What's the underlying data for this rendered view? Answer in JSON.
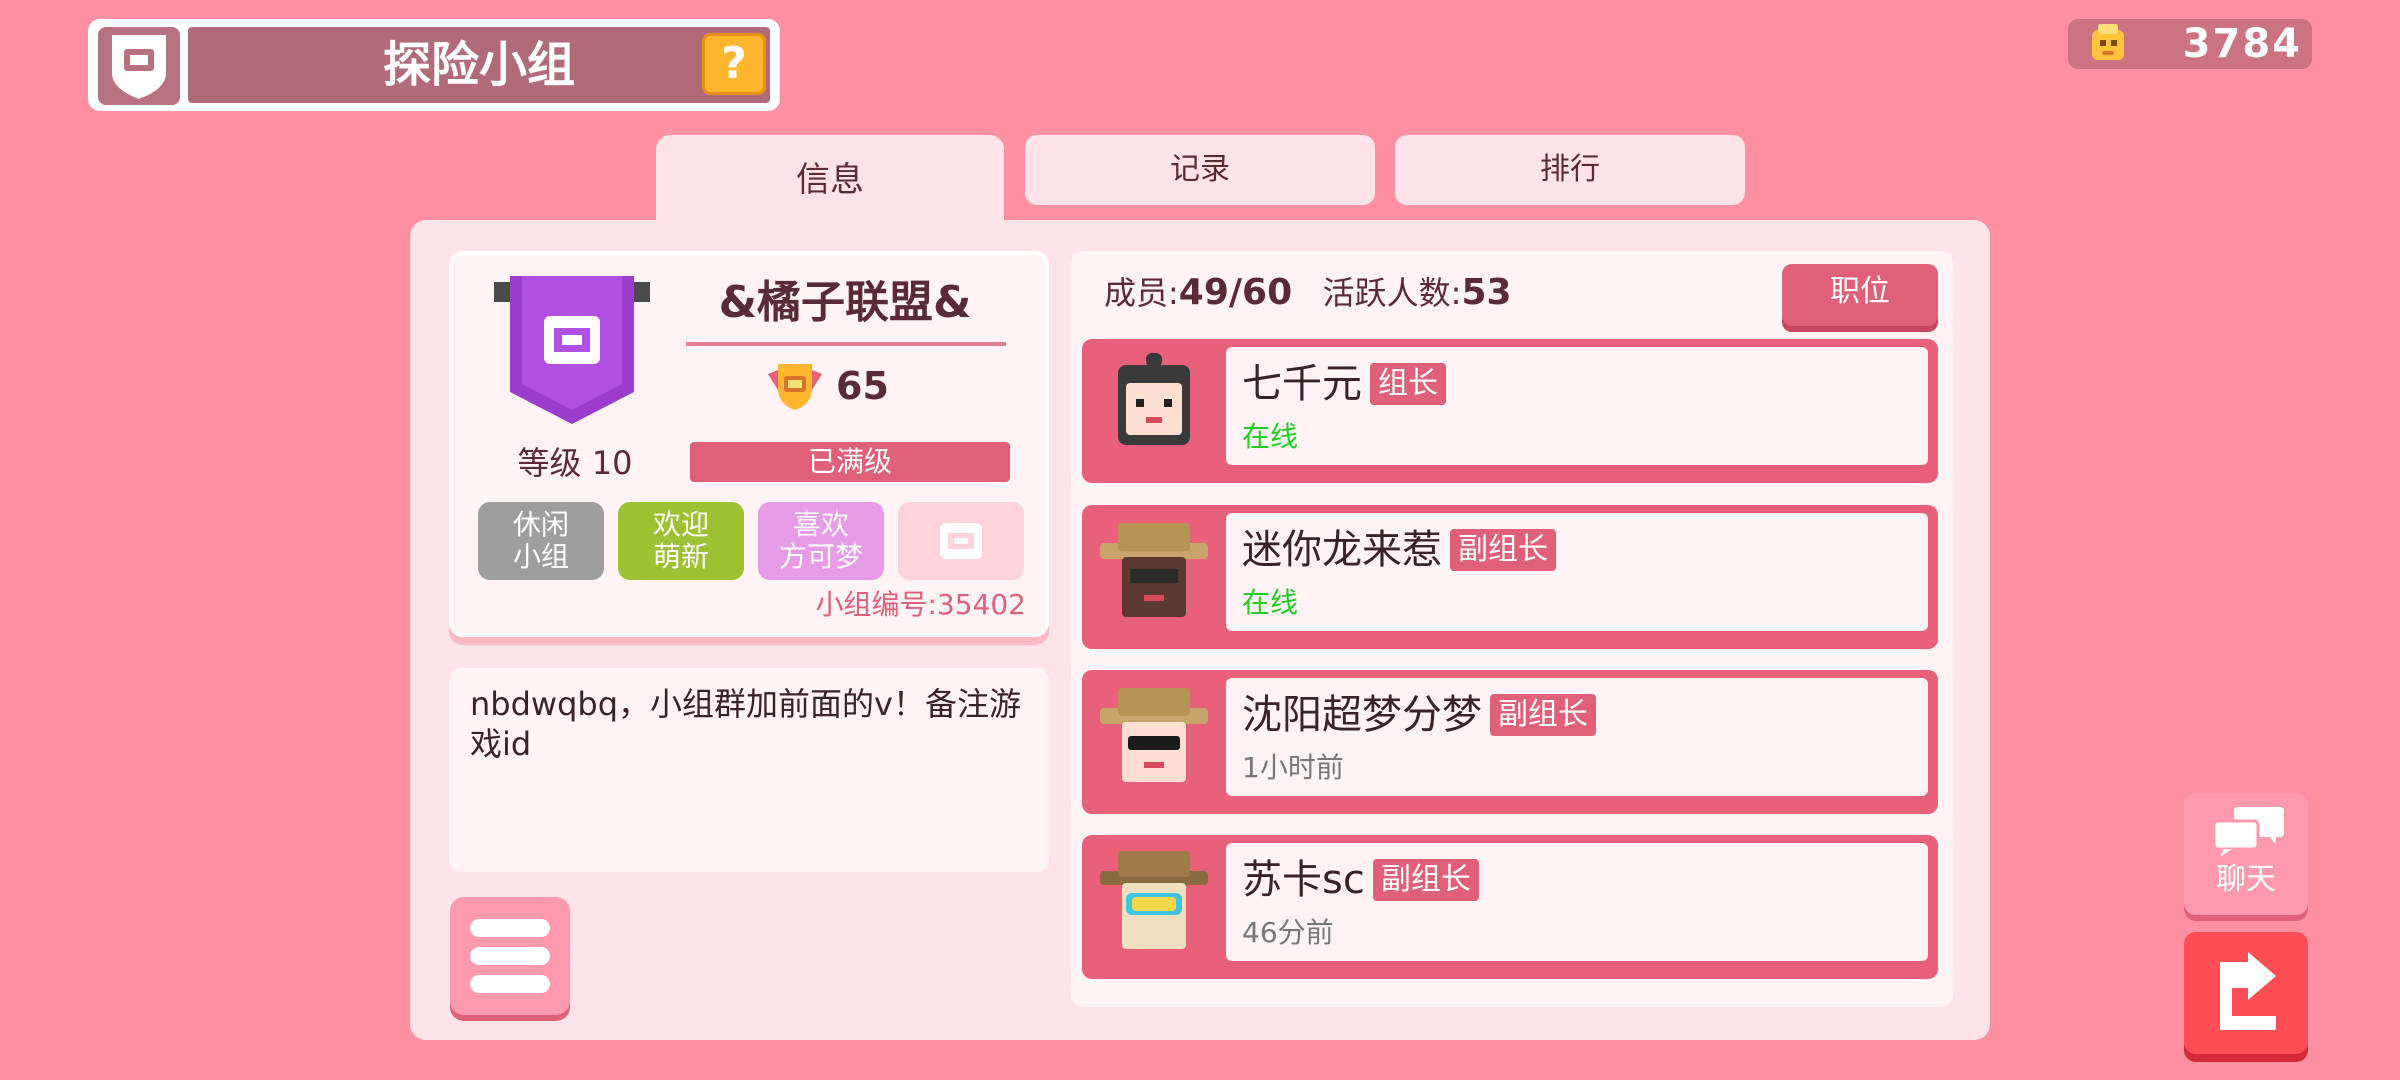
{
  "header": {
    "title": "探险小组",
    "help_icon": "question-icon",
    "coins": "3784"
  },
  "tabs": [
    {
      "label": "信息",
      "active": true
    },
    {
      "label": "记录",
      "active": false
    },
    {
      "label": "排行",
      "active": false
    }
  ],
  "group": {
    "name": "&橘子联盟&",
    "score": "65",
    "level": "等级 10",
    "level_status": "已满级",
    "tags": [
      {
        "label": "休闲\n小组",
        "color": "#9e9e9e"
      },
      {
        "label": "欢迎\n萌新",
        "color": "#9cc132"
      },
      {
        "label": "喜欢\n方可梦",
        "color": "#e79be6"
      }
    ],
    "group_id": "小组编号:35402",
    "description": "nbdwqbq，小组群加前面的v！备注游戏id"
  },
  "members_summary": {
    "count_label": "成员:",
    "count_value": "49/60",
    "active_label": "活跃人数:",
    "active_value": "53",
    "position_button": "职位"
  },
  "members": [
    {
      "name": "七千元",
      "role": "组长",
      "status": "在线",
      "online": true
    },
    {
      "name": "迷你龙来惹",
      "role": "副组长",
      "status": "在线",
      "online": true
    },
    {
      "name": "沈阳超梦分梦",
      "role": "副组长",
      "status": "1小时前",
      "online": false
    },
    {
      "name": "苏卡sc",
      "role": "副组长",
      "status": "46分前",
      "online": false
    }
  ],
  "side_buttons": {
    "chat_label": "聊天"
  },
  "colors": {
    "background": "#ff8fa2",
    "accent": "#e0607a",
    "online": "#22cc22",
    "offline": "#777777"
  }
}
